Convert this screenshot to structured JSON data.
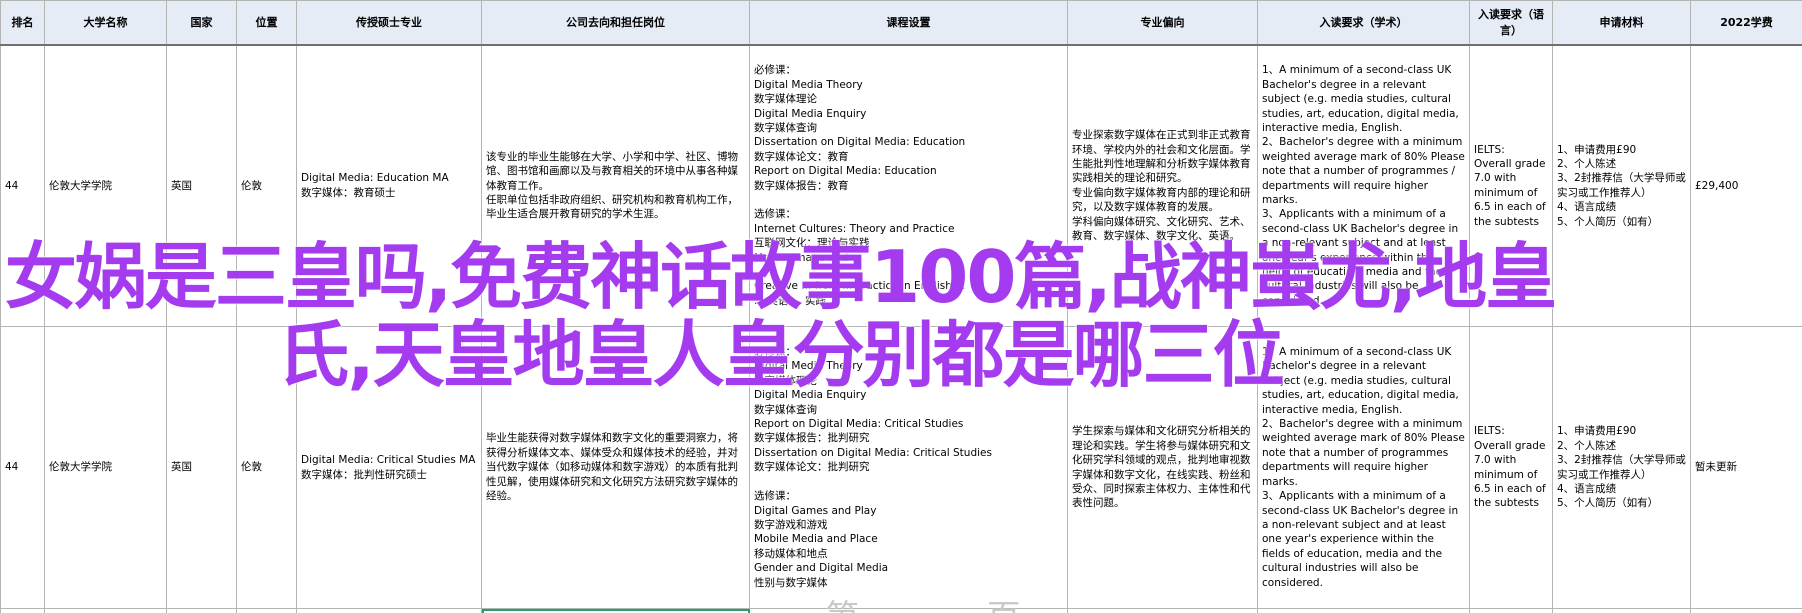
{
  "headers": [
    "排名",
    "大学名称",
    "国家",
    "位置",
    "传授硕士专业",
    "公司去向和担任岗位",
    "课程设置",
    "专业偏向",
    "入读要求（学术）",
    "入读要求（语言）",
    "申请材料",
    "2022学费"
  ],
  "rows": [
    {
      "rank": "44",
      "university": "伦敦大学学院",
      "country": "英国",
      "location": "伦敦",
      "program": "Digital Media: Education MA\n数字媒体：教育硕士",
      "career": "该专业的毕业生能够在大学、小学和中学、社区、博物馆、图书馆和画廊以及与教育相关的环境中从事各种媒体教育工作。\n任职单位包括非政府组织、研究机构和教育机构工作，毕业生适合展开教育研究的学术生涯。",
      "courses": "必修课：\nDigital Media Theory\n数字媒体理论\nDigital Media Enquiry\n数字媒体查询\nDissertation on Digital Media: Education\n数字媒体论文：教育\nReport on Digital Media: Education\n数字媒体报告：教育\n\n选修课：\nInternet Cultures: Theory and Practice\n互联网文化：理论与实践\nMedia, Image and ...\n...\nCreative ... from ... Practice in English ...\n... 英语 ... 实践 ...",
      "focus": "专业探索数字媒体在正式到非正式教育环境、学校内外的社会和文化层面。学生能批判性地理解和分析数字媒体教育实践相关的理论和研究。\n专业偏向数字媒体教育内部的理论和研究，以及数字媒体教育的发展。\n学科偏向媒体研究、文化研究、艺术、教育、数字媒体、数字文化、英语。",
      "academic": "1、A minimum of a second-class UK Bachelor's degree in a relevant subject (e.g. media studies, cultural studies, art, education, digital media, interactive media, English.\n2、Bachelor's degree with a minimum weighted average mark of 80% Please note that a number of programmes / departments will require higher marks.\n3、Applicants with a minimum of a second-class UK Bachelor's degree in a non-relevant subject and at least one year's experience within the fields of education, media and the cultural industries will also be considered.",
      "language": "IELTS:\nOverall grade 7.0 with minimum of 6.5 in each of the subtests",
      "materials": "1、申请费用£90\n2、个人陈述\n3、2封推荐信（大学导师或实习或工作推荐人）\n4、语言成绩\n5、个人简历（如有）",
      "tuition": "£29,400"
    },
    {
      "rank": "44",
      "university": "伦敦大学学院",
      "country": "英国",
      "location": "伦敦",
      "program": "Digital Media: Critical Studies MA\n数字媒体：批判性研究硕士",
      "career": "毕业生能获得对数字媒体和数字文化的重要洞察力，将获得分析媒体文本、媒体受众和媒体技术的经验，并对当代数字媒体（如移动媒体和数字游戏）的本质有批判性见解，使用媒体研究和文化研究方法研究数字媒体的经验。",
      "courses": "必修课：\nDigital Media Theory\n数字媒体理论\nDigital Media Enquiry\n数字媒体查询\nReport on Digital Media: Critical Studies\n数字媒体报告：批判研究\nDissertation on Digital Media: Critical Studies\n数字媒体论文：批判研究\n\n选修课：\nDigital Games and Play\n数字游戏和游戏\nMobile Media and Place\n移动媒体和地点\nGender and Digital Media\n性别与数字媒体",
      "focus": "学生探索与媒体和文化研究分析相关的理论和实践。学生将参与媒体研究和文化研究学科领域的观点，批判地审视数字媒体和数字文化，在线实践、粉丝和受众、同时探索主体权力、主体性和代表性问题。",
      "academic": "1、A minimum of a second-class UK Bachelor's degree in a relevant subject (e.g. media studies, cultural studies, art, education, digital media, interactive media, English.\n2、Bachelor's degree with a minimum weighted average mark of 80% Please note that a number of programmes departments will require higher marks.\n3、Applicants with a minimum of a second-class UK Bachelor's degree in a non-relevant subject and at least one year's experience within the fields of education, media and the cultural industries will also be considered.",
      "language": "IELTS:\nOverall grade 7.0 with minimum of 6.5 in each of the subtests",
      "materials": "1、申请费用£90\n2、个人陈述\n3、2封推荐信（大学导师或实习或工作推荐人）\n4、语言成绩\n5、个人简历（如有）",
      "tuition": "暂未更新"
    }
  ],
  "overlay_title": "女娲是三皇吗,免费神话故事100篇,战神蚩尤,地皇氏,天皇地皇人皇分别都是哪三位",
  "overlay_color": "#a43bee",
  "faint_text": "第 一 页"
}
